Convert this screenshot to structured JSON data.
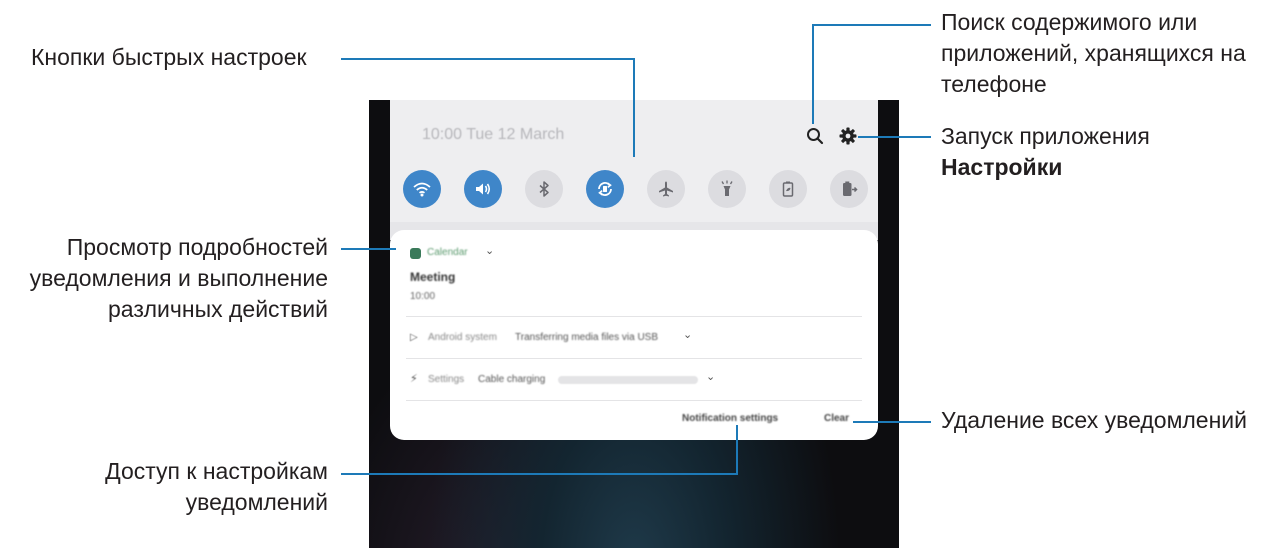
{
  "callouts": {
    "quick_settings_buttons": "Кнопки быстрых настроек",
    "search_line1": "Поиск содержимого или",
    "search_line2": "приложений, хранящихся на",
    "search_line3": "телефоне",
    "launch_settings_line1": "Запуск приложения",
    "launch_settings_bold": "Настройки",
    "view_details_line1": "Просмотр подробностей",
    "view_details_line2": "уведомления и выполнение",
    "view_details_line3": "различных действий",
    "clear_all": "Удаление всех уведомлений",
    "access_settings_line1": "Доступ к настройкам",
    "access_settings_line2": "уведомлений"
  },
  "phone": {
    "clock": "10:00  Tue 12 March",
    "quick_settings": [
      {
        "icon": "wifi-icon",
        "state": "on"
      },
      {
        "icon": "sound-icon",
        "state": "on"
      },
      {
        "icon": "bluetooth-icon",
        "state": "off"
      },
      {
        "icon": "auto-rotate-icon",
        "state": "on"
      },
      {
        "icon": "airplane-icon",
        "state": "off"
      },
      {
        "icon": "flashlight-icon",
        "state": "off"
      },
      {
        "icon": "power-saving-icon",
        "state": "off"
      },
      {
        "icon": "wireless-powershare-icon",
        "state": "off"
      }
    ],
    "notifications": {
      "calendar_app": "Calendar",
      "calendar_title": "Meeting",
      "calendar_time": "10:00",
      "android_app": "Android system",
      "android_text": "Transferring media files via USB",
      "settings_app": "Settings",
      "settings_text": "Cable charging",
      "notification_settings": "Notification settings",
      "clear": "Clear"
    }
  },
  "colors": {
    "accent": "#1d7ab8",
    "toggle_on": "#3f86c9",
    "toggle_off": "#dcdce0"
  }
}
